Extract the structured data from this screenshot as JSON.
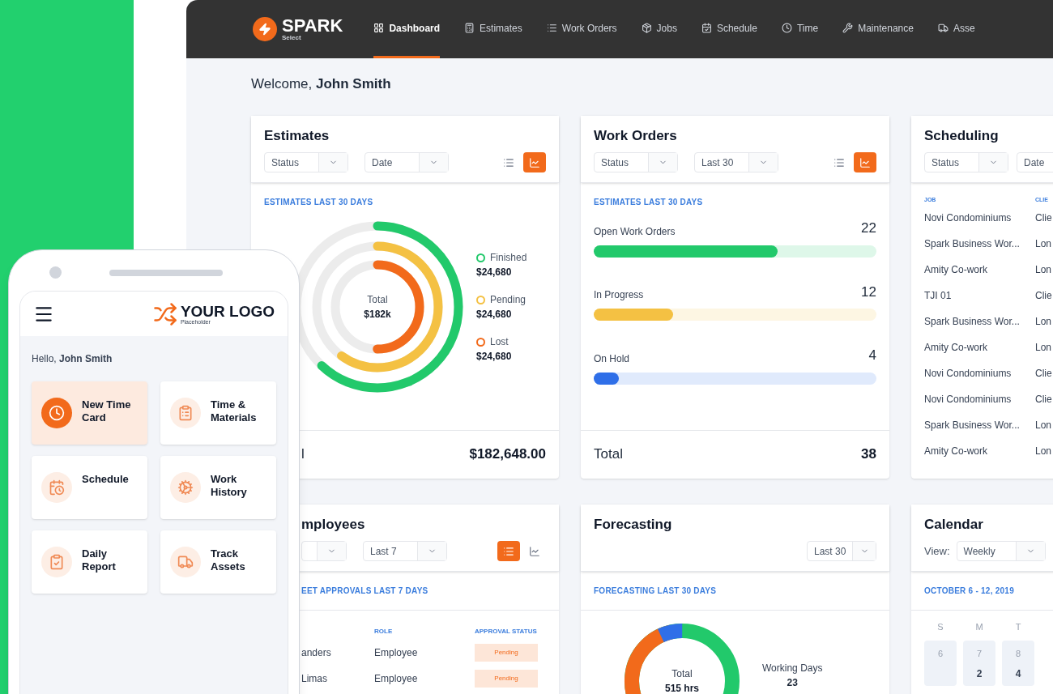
{
  "dashboard": {
    "brand": {
      "name": "SPARK",
      "tagline": "Select"
    },
    "nav": [
      {
        "label": "Dashboard",
        "selected": true
      },
      {
        "label": "Estimates",
        "selected": false
      },
      {
        "label": "Work Orders",
        "selected": false
      },
      {
        "label": "Jobs",
        "selected": false
      },
      {
        "label": "Schedule",
        "selected": false
      },
      {
        "label": "Time",
        "selected": false
      },
      {
        "label": "Maintenance",
        "selected": false
      },
      {
        "label": "Asse",
        "selected": false
      }
    ],
    "welcome": "Welcome, **John Smith**",
    "estimates": {
      "title": "Estimates",
      "filters": [
        "Status",
        "Date"
      ],
      "list_view_selected": false,
      "subtitle": "ESTIMATES LAST 30 DAYS",
      "center_label": "Total",
      "center_value": "$182k",
      "legend": [
        {
          "label": "Finished",
          "value": "$24,680",
          "color": "#22c96b"
        },
        {
          "label": "Pending",
          "value": "$24,680",
          "color": "#f4c143"
        },
        {
          "label": "Lost",
          "value": "$24,680",
          "color": "#f26a1b"
        }
      ],
      "footer_label": "l",
      "footer_value": "$182,648.00"
    },
    "work_orders": {
      "title": "Work Orders",
      "filters": [
        "Status",
        "Last 30"
      ],
      "list_view_selected": false,
      "subtitle": "ESTIMATES LAST 30 DAYS",
      "bars": [
        {
          "label": "Open Work Orders",
          "count": "22",
          "level": 0.65,
          "color": "#22c96b"
        },
        {
          "label": "In Progress",
          "count": "12",
          "level": 0.28,
          "color": "#f4c143"
        },
        {
          "label": "On Hold",
          "count": "4",
          "level": 0.09,
          "color": "#2f6fe8"
        }
      ],
      "footer_label": "Total",
      "footer_value": "38"
    },
    "scheduling": {
      "title": "Scheduling",
      "filters": [
        "Status",
        "Date"
      ],
      "columns": [
        "JOB",
        "CLIE"
      ],
      "rows": [
        {
          "job": "Novi Condominiums",
          "client": "Clie"
        },
        {
          "job": "Spark Business Wor...",
          "client": "Lon"
        },
        {
          "job": "Amity Co-work",
          "client": "Lon"
        },
        {
          "job": "TJI 01",
          "client": "Clie"
        },
        {
          "job": "Spark Business Wor...",
          "client": "Lon"
        },
        {
          "job": "Amity Co-work",
          "client": "Lon"
        },
        {
          "job": "Novi Condominiums",
          "client": "Clie"
        },
        {
          "job": "Novi Condominiums",
          "client": "Clie"
        },
        {
          "job": "Spark Business Wor...",
          "client": "Lon"
        },
        {
          "job": "Amity Co-work",
          "client": "Lon"
        }
      ]
    },
    "employees": {
      "title": "mployees",
      "filters": [
        "Last 7"
      ],
      "list_view_selected": true,
      "subtitle": "EET APPROVALS LAST 7 DAYS",
      "columns": [
        "ROLE",
        "APPROVAL STATUS"
      ],
      "rows": [
        {
          "name": "anders",
          "role": "Employee",
          "status": "Pending"
        },
        {
          "name": "Limas",
          "role": "Employee",
          "status": "Pending"
        }
      ]
    },
    "forecasting": {
      "title": "Forecasting",
      "filters": [
        "Last 30"
      ],
      "subtitle": "FORECASTING LAST 30 DAYS",
      "center_label": "Total",
      "center_value": "515 hrs",
      "stat_label": "Working Days",
      "stat_value": "23"
    },
    "calendar": {
      "title": "Calendar",
      "view_label": "View:",
      "view": "Weekly",
      "range": "OCTOBER 6 - 12, 2019",
      "days": [
        {
          "letter": "S",
          "date": "6"
        },
        {
          "letter": "M",
          "date": "7",
          "count": "2"
        },
        {
          "letter": "T",
          "date": "8",
          "count": "4"
        }
      ]
    }
  },
  "phone": {
    "logo": "YOUR LOGO",
    "logo_tagline": "Placeholder",
    "greeting": "Hello, **John Smith**",
    "tiles": [
      {
        "label": "New Time Card",
        "selected": true
      },
      {
        "label": "Time & Materials",
        "selected": false
      },
      {
        "label": "Schedule",
        "selected": false
      },
      {
        "label": "Work History",
        "selected": false
      },
      {
        "label": "Daily Report",
        "selected": false
      },
      {
        "label": "Track Assets",
        "selected": false
      }
    ]
  }
}
